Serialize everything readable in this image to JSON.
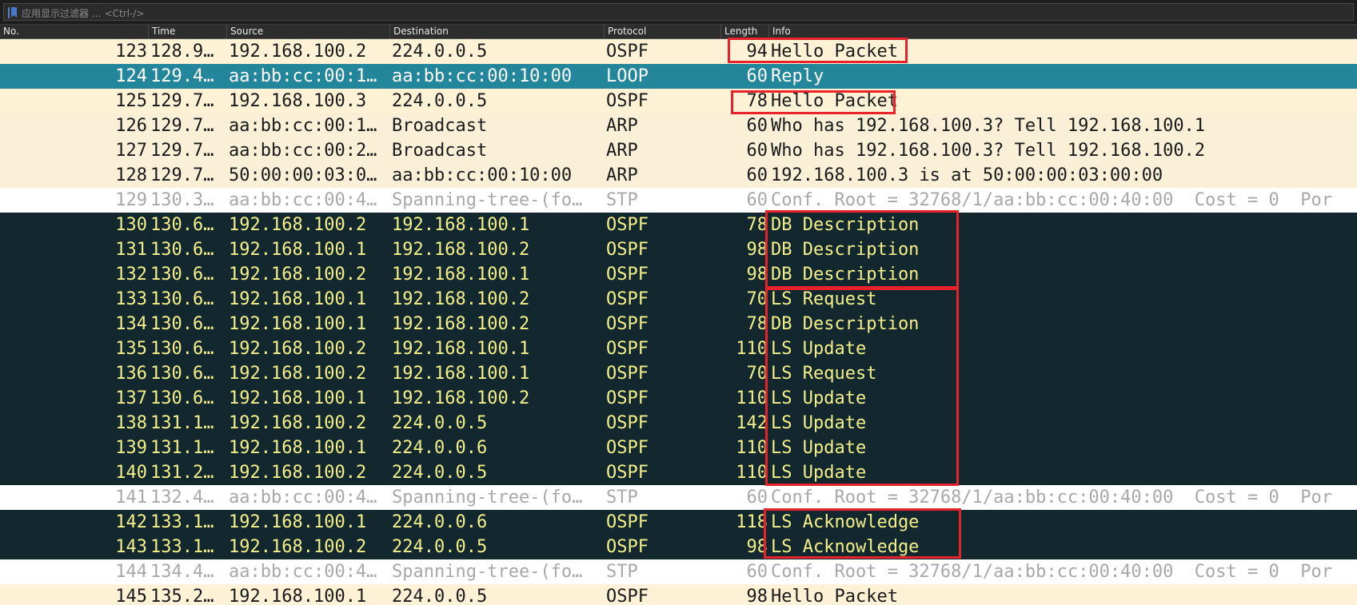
{
  "filter": {
    "placeholder": "应用显示过滤器 … <Ctrl-/>",
    "icon": "bookmark-icon"
  },
  "columns": {
    "no": "No.",
    "time": "Time",
    "source": "Source",
    "destination": "Destination",
    "protocol": "Protocol",
    "length": "Length",
    "info": "Info"
  },
  "colors": {
    "ospf_bg": "#fdf1d6",
    "selected_bg": "#23869b",
    "dark_bg": "#12272e",
    "dark_fg": "#f3f08a",
    "stp_fg": "#a8a8a8",
    "annotation": "#e8222a"
  },
  "packets": [
    {
      "no": "123",
      "time": "128.9…",
      "source": "192.168.100.2",
      "destination": "224.0.0.5",
      "protocol": "OSPF",
      "length": "94",
      "info": "Hello Packet"
    },
    {
      "no": "124",
      "time": "129.4…",
      "source": "aa:bb:cc:00:1…",
      "destination": "aa:bb:cc:00:10:00",
      "protocol": "LOOP",
      "length": "60",
      "info": "Reply"
    },
    {
      "no": "125",
      "time": "129.7…",
      "source": "192.168.100.3",
      "destination": "224.0.0.5",
      "protocol": "OSPF",
      "length": "78",
      "info": "Hello Packet"
    },
    {
      "no": "126",
      "time": "129.7…",
      "source": "aa:bb:cc:00:1…",
      "destination": "Broadcast",
      "protocol": "ARP",
      "length": "60",
      "info": "Who has 192.168.100.3? Tell 192.168.100.1"
    },
    {
      "no": "127",
      "time": "129.7…",
      "source": "aa:bb:cc:00:2…",
      "destination": "Broadcast",
      "protocol": "ARP",
      "length": "60",
      "info": "Who has 192.168.100.3? Tell 192.168.100.2"
    },
    {
      "no": "128",
      "time": "129.7…",
      "source": "50:00:00:03:0…",
      "destination": "aa:bb:cc:00:10:00",
      "protocol": "ARP",
      "length": "60",
      "info": "192.168.100.3 is at 50:00:00:03:00:00"
    },
    {
      "no": "129",
      "time": "130.3…",
      "source": "aa:bb:cc:00:4…",
      "destination": "Spanning-tree-(fo…",
      "protocol": "STP",
      "length": "60",
      "info": "Conf. Root = 32768/1/aa:bb:cc:00:40:00  Cost = 0  Por"
    },
    {
      "no": "130",
      "time": "130.6…",
      "source": "192.168.100.2",
      "destination": "192.168.100.1",
      "protocol": "OSPF",
      "length": "78",
      "info": "DB Description"
    },
    {
      "no": "131",
      "time": "130.6…",
      "source": "192.168.100.1",
      "destination": "192.168.100.2",
      "protocol": "OSPF",
      "length": "98",
      "info": "DB Description"
    },
    {
      "no": "132",
      "time": "130.6…",
      "source": "192.168.100.2",
      "destination": "192.168.100.1",
      "protocol": "OSPF",
      "length": "98",
      "info": "DB Description"
    },
    {
      "no": "133",
      "time": "130.6…",
      "source": "192.168.100.1",
      "destination": "192.168.100.2",
      "protocol": "OSPF",
      "length": "70",
      "info": "LS Request"
    },
    {
      "no": "134",
      "time": "130.6…",
      "source": "192.168.100.1",
      "destination": "192.168.100.2",
      "protocol": "OSPF",
      "length": "78",
      "info": "DB Description"
    },
    {
      "no": "135",
      "time": "130.6…",
      "source": "192.168.100.2",
      "destination": "192.168.100.1",
      "protocol": "OSPF",
      "length": "110",
      "info": "LS Update"
    },
    {
      "no": "136",
      "time": "130.6…",
      "source": "192.168.100.2",
      "destination": "192.168.100.1",
      "protocol": "OSPF",
      "length": "70",
      "info": "LS Request"
    },
    {
      "no": "137",
      "time": "130.6…",
      "source": "192.168.100.1",
      "destination": "192.168.100.2",
      "protocol": "OSPF",
      "length": "110",
      "info": "LS Update"
    },
    {
      "no": "138",
      "time": "131.1…",
      "source": "192.168.100.2",
      "destination": "224.0.0.5",
      "protocol": "OSPF",
      "length": "142",
      "info": "LS Update"
    },
    {
      "no": "139",
      "time": "131.1…",
      "source": "192.168.100.1",
      "destination": "224.0.0.6",
      "protocol": "OSPF",
      "length": "110",
      "info": "LS Update"
    },
    {
      "no": "140",
      "time": "131.2…",
      "source": "192.168.100.2",
      "destination": "224.0.0.5",
      "protocol": "OSPF",
      "length": "110",
      "info": "LS Update"
    },
    {
      "no": "141",
      "time": "132.4…",
      "source": "aa:bb:cc:00:4…",
      "destination": "Spanning-tree-(fo…",
      "protocol": "STP",
      "length": "60",
      "info": "Conf. Root = 32768/1/aa:bb:cc:00:40:00  Cost = 0  Por"
    },
    {
      "no": "142",
      "time": "133.1…",
      "source": "192.168.100.1",
      "destination": "224.0.0.6",
      "protocol": "OSPF",
      "length": "118",
      "info": "LS Acknowledge"
    },
    {
      "no": "143",
      "time": "133.1…",
      "source": "192.168.100.2",
      "destination": "224.0.0.5",
      "protocol": "OSPF",
      "length": "98",
      "info": "LS Acknowledge"
    },
    {
      "no": "144",
      "time": "134.4…",
      "source": "aa:bb:cc:00:4…",
      "destination": "Spanning-tree-(fo…",
      "protocol": "STP",
      "length": "60",
      "info": "Conf. Root = 32768/1/aa:bb:cc:00:40:00  Cost = 0  Por"
    },
    {
      "no": "145",
      "time": "135.2…",
      "source": "192.168.100.1",
      "destination": "224.0.0.5",
      "protocol": "OSPF",
      "length": "98",
      "info": "Hello Packet"
    }
  ]
}
